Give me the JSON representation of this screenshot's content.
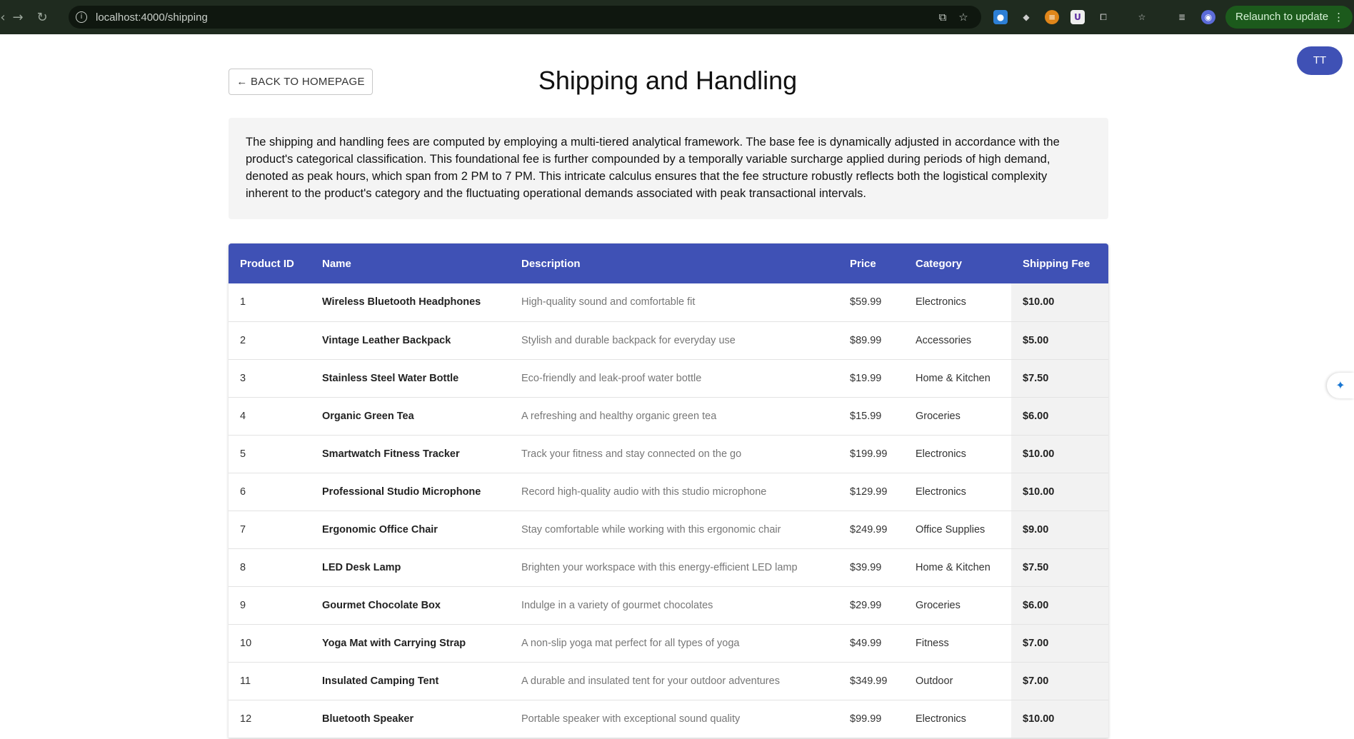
{
  "browser": {
    "url": "localhost:4000/shipping",
    "relaunch_label": "Relaunch to update"
  },
  "header": {
    "back_label": "← BACK TO HOMEPAGE",
    "title": "Shipping and Handling",
    "avatar_initials": "TT"
  },
  "intro": {
    "text": "The shipping and handling fees are computed by employing a multi-tiered analytical framework. The base fee is dynamically adjusted in accordance with the product's categorical classification. This foundational fee is further compounded by a temporally variable surcharge applied during periods of high demand, denoted as peak hours, which span from 2 PM to 7 PM. This intricate calculus ensures that the fee structure robustly reflects both the logistical complexity inherent to the product's category and the fluctuating operational demands associated with peak transactional intervals."
  },
  "table": {
    "columns": [
      "Product ID",
      "Name",
      "Description",
      "Price",
      "Category",
      "Shipping Fee"
    ],
    "rows": [
      {
        "id": "1",
        "name": "Wireless Bluetooth Headphones",
        "description": "High-quality sound and comfortable fit",
        "price": "$59.99",
        "category": "Electronics",
        "fee": "$10.00"
      },
      {
        "id": "2",
        "name": "Vintage Leather Backpack",
        "description": "Stylish and durable backpack for everyday use",
        "price": "$89.99",
        "category": "Accessories",
        "fee": "$5.00"
      },
      {
        "id": "3",
        "name": "Stainless Steel Water Bottle",
        "description": "Eco-friendly and leak-proof water bottle",
        "price": "$19.99",
        "category": "Home & Kitchen",
        "fee": "$7.50"
      },
      {
        "id": "4",
        "name": "Organic Green Tea",
        "description": "A refreshing and healthy organic green tea",
        "price": "$15.99",
        "category": "Groceries",
        "fee": "$6.00"
      },
      {
        "id": "5",
        "name": "Smartwatch Fitness Tracker",
        "description": "Track your fitness and stay connected on the go",
        "price": "$199.99",
        "category": "Electronics",
        "fee": "$10.00"
      },
      {
        "id": "6",
        "name": "Professional Studio Microphone",
        "description": "Record high-quality audio with this studio microphone",
        "price": "$129.99",
        "category": "Electronics",
        "fee": "$10.00"
      },
      {
        "id": "7",
        "name": "Ergonomic Office Chair",
        "description": "Stay comfortable while working with this ergonomic chair",
        "price": "$249.99",
        "category": "Office Supplies",
        "fee": "$9.00"
      },
      {
        "id": "8",
        "name": "LED Desk Lamp",
        "description": "Brighten your workspace with this energy-efficient LED lamp",
        "price": "$39.99",
        "category": "Home & Kitchen",
        "fee": "$7.50"
      },
      {
        "id": "9",
        "name": "Gourmet Chocolate Box",
        "description": "Indulge in a variety of gourmet chocolates",
        "price": "$29.99",
        "category": "Groceries",
        "fee": "$6.00"
      },
      {
        "id": "10",
        "name": "Yoga Mat with Carrying Strap",
        "description": "A non-slip yoga mat perfect for all types of yoga",
        "price": "$49.99",
        "category": "Fitness",
        "fee": "$7.00"
      },
      {
        "id": "11",
        "name": "Insulated Camping Tent",
        "description": "A durable and insulated tent for your outdoor adventures",
        "price": "$349.99",
        "category": "Outdoor",
        "fee": "$7.00"
      },
      {
        "id": "12",
        "name": "Bluetooth Speaker",
        "description": "Portable speaker with exceptional sound quality",
        "price": "$99.99",
        "category": "Electronics",
        "fee": "$10.00"
      }
    ]
  },
  "colors": {
    "header_blue": "#3f51b5",
    "fee_column_bg": "#f2f2f2"
  }
}
